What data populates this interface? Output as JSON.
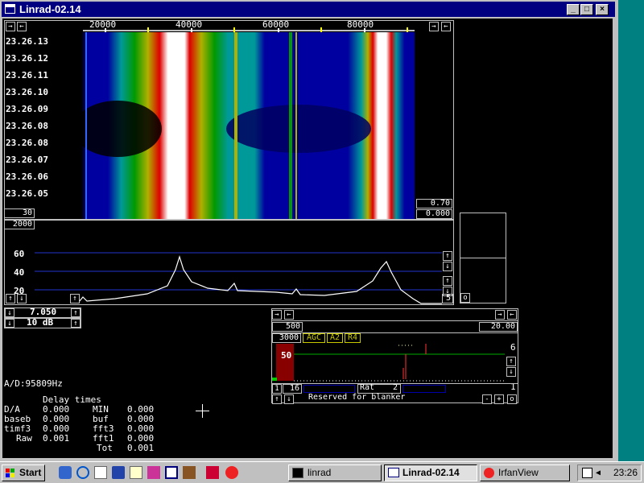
{
  "window": {
    "title": "Linrad-02.14",
    "buttons": [
      "_",
      "□",
      "×"
    ]
  },
  "waterfall": {
    "freq_labels": [
      "20000",
      "40000",
      "60000",
      "80000"
    ],
    "time_labels": [
      "23.26.13",
      "23.26.12",
      "23.26.11",
      "23.26.10",
      "23.26.09",
      "23.26.08",
      "23.26.08",
      "23.26.07",
      "23.26.06",
      "23.26.05"
    ],
    "avg_value": "30",
    "gain_value": "0.70",
    "zero_value": "0.000"
  },
  "spectrum": {
    "top_value": "2000",
    "y_labels": [
      "60",
      "40",
      "20"
    ],
    "corner_value": "5"
  },
  "controls": {
    "freq_value": "7.050",
    "db_value": "10 dB"
  },
  "ad_rate": "A/D:95809Hz",
  "delay_times": {
    "header": "Delay times",
    "rows": [
      {
        "l1": "D/A",
        "v1": "0.000",
        "l2": "MIN",
        "v2": "0.000"
      },
      {
        "l1": "baseb",
        "v1": "0.000",
        "l2": "buf",
        "v2": "0.000"
      },
      {
        "l1": "timf3",
        "v1": "0.000",
        "l2": "fft3",
        "v2": "0.000"
      },
      {
        "l1": "Raw",
        "v1": "0.001",
        "l2": "fft1",
        "v2": "0.000"
      },
      {
        "l1": "",
        "v1": "",
        "l2": "Tot",
        "v2": "0.001"
      }
    ]
  },
  "small_box": {
    "label": "o"
  },
  "baseband": {
    "left_value": "500",
    "right_value": "20.00",
    "bandwidth": "3000",
    "agc": "AGC",
    "a2": "A2",
    "r4": "R4",
    "level": "50",
    "right_num_top": "6",
    "right_num_bottom": "1",
    "btn_1": "1",
    "btn_16": "16",
    "rat_label": "Rat",
    "rat_value": "2",
    "blanker": "Reserved for blanker",
    "minus": "-",
    "plus": "+",
    "o": "o"
  },
  "taskbar": {
    "start": "Start",
    "tasks": [
      {
        "label": "linrad",
        "active": false
      },
      {
        "label": "Linrad-02.14",
        "active": true
      },
      {
        "label": "IrfanView",
        "active": false
      }
    ],
    "clock": "23:26"
  },
  "colors": {
    "title_bar": "#000080",
    "desktop": "#008080",
    "waterfall_blue": "#000090",
    "waterfall_teal": "#009999",
    "waterfall_green": "#009900",
    "waterfall_yellow": "#a8a800",
    "waterfall_red": "#dd0000",
    "spectrum_grid": "#2233cc",
    "agc_text": "#c8c800",
    "baseband_bar": "#880000"
  }
}
